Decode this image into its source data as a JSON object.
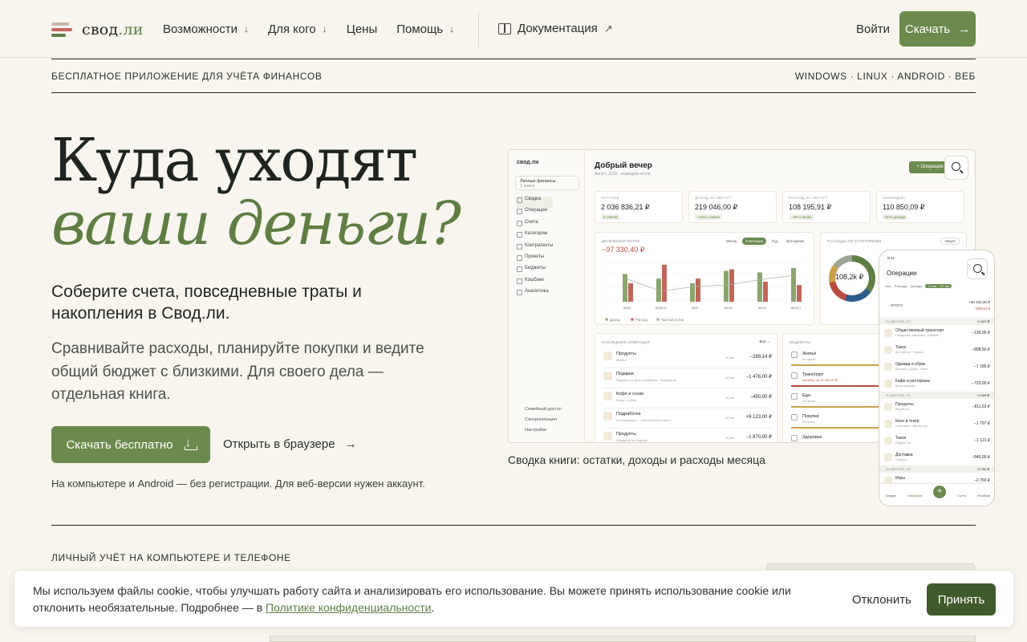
{
  "brand": {
    "name_part1": "свод",
    "name_part2": ".ли"
  },
  "nav": {
    "items": [
      {
        "label": "Возможности",
        "has_dropdown": true
      },
      {
        "label": "Для кого",
        "has_dropdown": true
      },
      {
        "label": "Цены",
        "has_dropdown": false
      },
      {
        "label": "Помощь",
        "has_dropdown": true
      }
    ],
    "docs_label": "Документация",
    "login_label": "Войти",
    "download_label": "Скачать"
  },
  "strip": {
    "left": "БЕСПЛАТНОЕ ПРИЛОЖЕНИЕ ДЛЯ УЧЁТА ФИНАНСОВ",
    "right": "WINDOWS · LINUX · ANDROID · ВЕБ"
  },
  "hero": {
    "title_line1": "Куда уходят",
    "title_line2": "ваши деньги?",
    "lead": "Соберите счета, повседневные траты и накопления в Свод.ли.",
    "sub": "Сравнивайте расходы, планируйте покупки и ведите общий бюджет с близкими. Для своего дела — отдельная книга.",
    "cta_label": "Скачать бесплатно",
    "browser_label": "Открыть в браузере",
    "note": "На компьютере и Android — без регистрации. Для веб-версии нужен аккаунт."
  },
  "app": {
    "logo": "свод.ли",
    "space_name": "Личные финансы",
    "space_sub": "1 книга",
    "menu": [
      "Сводка",
      "Операции",
      "Счета",
      "Категории",
      "Контрагенты",
      "Проекты",
      "Бюджеты",
      "Кэшбэки",
      "Аналитика"
    ],
    "bottom_menu": [
      "Семейный доступ",
      "Синхронизация",
      "Настройки"
    ],
    "greeting": "Добрый вечер",
    "period_sub": "Август, 2026 · подведём итоги",
    "op_button": "+ Операция",
    "kpis": [
      {
        "label": "ОСТАТОК",
        "value": "2 036 836,21 ₽",
        "badge": "5 счетов"
      },
      {
        "label": "ДОХОД ЗА АВГУСТ",
        "value": "219 046,00 ₽",
        "badge": "+12% к июлю"
      },
      {
        "label": "РАСХОД ЗА АВГУСТ",
        "value": "108 195,91 ₽",
        "badge": "−4% к июлю"
      },
      {
        "label": "СВОБОДНО",
        "value": "110 850,09 ₽",
        "badge": "51% дохода"
      }
    ],
    "flow": {
      "title": "ДЕНЕЖНЫЙ ПОТОК",
      "value": "−97 330,40 ₽",
      "tabs": [
        "Месяц",
        "6 месяцев",
        "Год",
        "Всё время"
      ],
      "active_tab": 1,
      "months": [
        "март",
        "апрель",
        "май",
        "июнь",
        "июль",
        "август"
      ],
      "legend": [
        "Доход",
        "Расход",
        "Чистый поток"
      ]
    },
    "categories": {
      "title": "РАСХОДЫ ПО КАТЕГОРИЯМ",
      "period": "Август",
      "total": "108,2k ₽",
      "total_sub": "АВГУСТ"
    },
    "recent": {
      "title": "ПОСЛЕДНИЕ ОПЕРАЦИИ",
      "all": "Все →",
      "rows": [
        {
          "name": "Продукты",
          "sub": "Магнит",
          "date": "15 авг.",
          "amount": "−289,14 ₽"
        },
        {
          "name": "Подарки",
          "sub": "Подарок на день рождения · Подарки.by",
          "date": "15 авг.",
          "amount": "−1 476,00 ₽"
        },
        {
          "name": "Кофе и снэки",
          "sub": "Кофе с собой",
          "date": "15 авг.",
          "amount": "−450,00 ₽"
        },
        {
          "name": "Подработка",
          "sub": "Консультация · Самозанятый клиент",
          "date": "15 авг.",
          "amount": "+9 123,00 ₽"
        },
        {
          "name": "Продукты",
          "sub": "Продукты на неделю",
          "date": "15 авг.",
          "amount": "−1 870,00 ₽"
        }
      ]
    },
    "budgets": {
      "title": "БЮДЖЕТЫ",
      "rows": [
        {
          "name": "Жильё",
          "sub": "на грани",
          "color": "#c9a14a"
        },
        {
          "name": "Транспорт",
          "sub": "перебор на 10 400,00 ₽",
          "color": "#b94c3e"
        },
        {
          "name": "Еда",
          "sub": "на грани",
          "color": "#c9a14a"
        },
        {
          "name": "Покупки",
          "sub": "на грани",
          "color": "#c9a14a"
        },
        {
          "name": "Здоровье",
          "sub": "",
          "color": "#5f7e44"
        }
      ]
    }
  },
  "phone": {
    "time": "9:41",
    "title": "Операции",
    "chips": [
      "Все",
      "Расходы",
      "Доходы",
      "13 авг – 31 авг"
    ],
    "summary_label": "ИТОГО",
    "summary_values": [
      "+40 132,30 ₽",
      "−250,94 $"
    ],
    "groups": [
      {
        "date": "31 АВГУСТА, ПТ",
        "total": "−2 847 ₽",
        "rows": [
          {
            "name": "Общественный транспорт",
            "sub": "Городской транспорт · Бейбик",
            "amount": "−130,00 ₽"
          },
          {
            "name": "Такси",
            "sub": "До работы · Яндекс",
            "amount": "−808,50 ₽"
          },
          {
            "name": "Одежда и обувь",
            "sub": "Магазин у дома · Ozon",
            "amount": "−1 185 ₽"
          },
          {
            "name": "Кафе и рестораны",
            "sub": "Шоколадница",
            "amount": "−723,00 ₽"
          }
        ]
      },
      {
        "date": "30 АВГУСТА, ЧТ",
        "total": "−4 509 ₽",
        "rows": [
          {
            "name": "Продукты",
            "sub": "ВкусВилл",
            "amount": "−811,63 ₽"
          },
          {
            "name": "Кино и театр",
            "sub": "Спектакль · Билеты.ру",
            "amount": "−1 797 ₽"
          },
          {
            "name": "Такси",
            "sub": "Яндекс Go",
            "amount": "−1 121 ₽"
          },
          {
            "name": "Доставка",
            "sub": "Самокат",
            "amount": "−840,00 ₽"
          }
        ]
      },
      {
        "date": "29 АВГУСТА, СР",
        "total": "−2 760 ₽",
        "rows": [
          {
            "name": "Игры",
            "sub": "",
            "amount": "−2 760 ₽"
          }
        ]
      }
    ],
    "tabbar": [
      "Сводка",
      "Операции",
      "",
      "Счета",
      "Кэшбэки"
    ]
  },
  "caption": "Сводка книги: остатки, доходы и расходы месяца",
  "section2": {
    "label": "ЛИЧНЫЙ УЧЁТ НА КОМПЬЮТЕРЕ И ТЕЛЕФОНЕ"
  },
  "cookie": {
    "text": "Мы используем файлы cookie, чтобы улучшать работу сайта и анализировать его использование. Вы можете принять использование cookie или отклонить необязательные. Подробнее — в ",
    "link": "Политике конфиденциальности",
    "tail": ".",
    "decline": "Отклонить",
    "accept": "Принять"
  },
  "chart_data": {
    "type": "bar",
    "categories": [
      "март",
      "апрель",
      "май",
      "июнь",
      "июль",
      "август"
    ],
    "series": [
      {
        "name": "Доход",
        "values": [
          180,
          150,
          120,
          200,
          190,
          219
        ]
      },
      {
        "name": "Расход",
        "values": [
          120,
          240,
          150,
          210,
          130,
          108
        ]
      },
      {
        "name": "Чистый поток",
        "values": [
          60,
          -90,
          -30,
          -10,
          60,
          111
        ]
      }
    ]
  }
}
